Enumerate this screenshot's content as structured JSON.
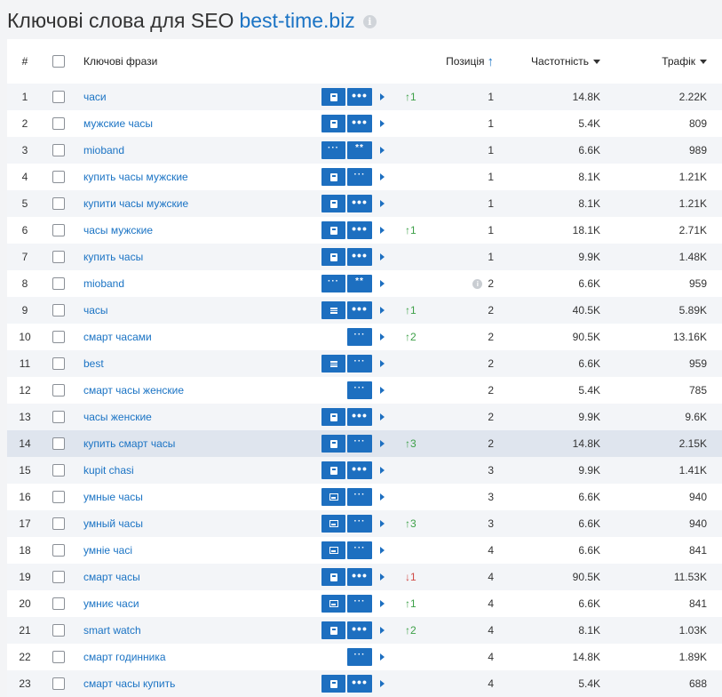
{
  "title": {
    "text": "Ключові слова для SEO",
    "domain": "best-time.biz"
  },
  "header": {
    "num": "#",
    "keywords": "Ключові фрази",
    "position": "Позиція",
    "frequency": "Частотність",
    "traffic": "Трафік"
  },
  "colors": {
    "accent": "#1d6fc0",
    "link": "#1a73c4",
    "up": "#3da048",
    "down": "#d04a45"
  },
  "rows": [
    {
      "num": "1",
      "kw": "часи",
      "b1": "doc",
      "b2": "dots",
      "chg": "1",
      "dir": "up",
      "pos": "1",
      "freq": "14.8K",
      "traf": "2.22K"
    },
    {
      "num": "2",
      "kw": "мужские часы",
      "b1": "doc",
      "b2": "dots",
      "chg": "",
      "dir": "",
      "pos": "1",
      "freq": "5.4K",
      "traf": "809"
    },
    {
      "num": "3",
      "kw": "mioband",
      "b1": "dots-light",
      "b2": "stars",
      "chg": "",
      "dir": "",
      "pos": "1",
      "freq": "6.6K",
      "traf": "989"
    },
    {
      "num": "4",
      "kw": "купить часы мужские",
      "b1": "doc",
      "b2": "dots-light",
      "chg": "",
      "dir": "",
      "pos": "1",
      "freq": "8.1K",
      "traf": "1.21K"
    },
    {
      "num": "5",
      "kw": "купити часы мужские",
      "b1": "doc",
      "b2": "dots",
      "chg": "",
      "dir": "",
      "pos": "1",
      "freq": "8.1K",
      "traf": "1.21K"
    },
    {
      "num": "6",
      "kw": "часы мужские",
      "b1": "doc",
      "b2": "dots",
      "chg": "1",
      "dir": "up",
      "pos": "1",
      "freq": "18.1K",
      "traf": "2.71K"
    },
    {
      "num": "7",
      "kw": "купить часы",
      "b1": "doc",
      "b2": "dots",
      "chg": "",
      "dir": "",
      "pos": "1",
      "freq": "9.9K",
      "traf": "1.48K"
    },
    {
      "num": "8",
      "kw": "mioband",
      "b1": "dots-light",
      "b2": "stars",
      "chg": "",
      "dir": "",
      "pos": "2",
      "freq": "6.6K",
      "traf": "959",
      "info": true
    },
    {
      "num": "9",
      "kw": "часы",
      "b1": "lines",
      "b2": "dots",
      "chg": "1",
      "dir": "up",
      "pos": "2",
      "freq": "40.5K",
      "traf": "5.89K"
    },
    {
      "num": "10",
      "kw": "смарт часами",
      "b1": "",
      "b2": "dots-light",
      "chg": "2",
      "dir": "up",
      "pos": "2",
      "freq": "90.5K",
      "traf": "13.16K"
    },
    {
      "num": "11",
      "kw": "best",
      "b1": "lines",
      "b2": "dots-light",
      "chg": "",
      "dir": "",
      "pos": "2",
      "freq": "6.6K",
      "traf": "959"
    },
    {
      "num": "12",
      "kw": "смарт часы женские",
      "b1": "",
      "b2": "dots-light",
      "chg": "",
      "dir": "",
      "pos": "2",
      "freq": "5.4K",
      "traf": "785"
    },
    {
      "num": "13",
      "kw": "часы женские",
      "b1": "doc",
      "b2": "dots",
      "chg": "",
      "dir": "",
      "pos": "2",
      "freq": "9.9K",
      "traf": "9.6K"
    },
    {
      "num": "14",
      "kw": "купить смарт часы",
      "b1": "doc",
      "b2": "dots-light",
      "chg": "3",
      "dir": "up",
      "pos": "2",
      "freq": "14.8K",
      "traf": "2.15K",
      "hl": true
    },
    {
      "num": "15",
      "kw": "kupit chasi",
      "b1": "doc",
      "b2": "dots",
      "chg": "",
      "dir": "",
      "pos": "3",
      "freq": "9.9K",
      "traf": "1.41K"
    },
    {
      "num": "16",
      "kw": "умные часы",
      "b1": "img",
      "b2": "dots-light",
      "chg": "",
      "dir": "",
      "pos": "3",
      "freq": "6.6K",
      "traf": "940"
    },
    {
      "num": "17",
      "kw": "умный часы",
      "b1": "img",
      "b2": "dots-light",
      "chg": "3",
      "dir": "up",
      "pos": "3",
      "freq": "6.6K",
      "traf": "940"
    },
    {
      "num": "18",
      "kw": "умніе часі",
      "b1": "img",
      "b2": "dots-light",
      "chg": "",
      "dir": "",
      "pos": "4",
      "freq": "6.6K",
      "traf": "841"
    },
    {
      "num": "19",
      "kw": "смарт часы",
      "b1": "doc",
      "b2": "dots",
      "chg": "1",
      "dir": "down",
      "pos": "4",
      "freq": "90.5K",
      "traf": "11.53K"
    },
    {
      "num": "20",
      "kw": "умниє часи",
      "b1": "img",
      "b2": "dots-light",
      "chg": "1",
      "dir": "up",
      "pos": "4",
      "freq": "6.6K",
      "traf": "841"
    },
    {
      "num": "21",
      "kw": "smart watch",
      "b1": "doc",
      "b2": "dots",
      "chg": "2",
      "dir": "up",
      "pos": "4",
      "freq": "8.1K",
      "traf": "1.03K"
    },
    {
      "num": "22",
      "kw": "смарт годинника",
      "b1": "",
      "b2": "dots-light",
      "chg": "",
      "dir": "",
      "pos": "4",
      "freq": "14.8K",
      "traf": "1.89K"
    },
    {
      "num": "23",
      "kw": "смарт часы купить",
      "b1": "doc",
      "b2": "dots",
      "chg": "",
      "dir": "",
      "pos": "4",
      "freq": "5.4K",
      "traf": "688"
    }
  ]
}
